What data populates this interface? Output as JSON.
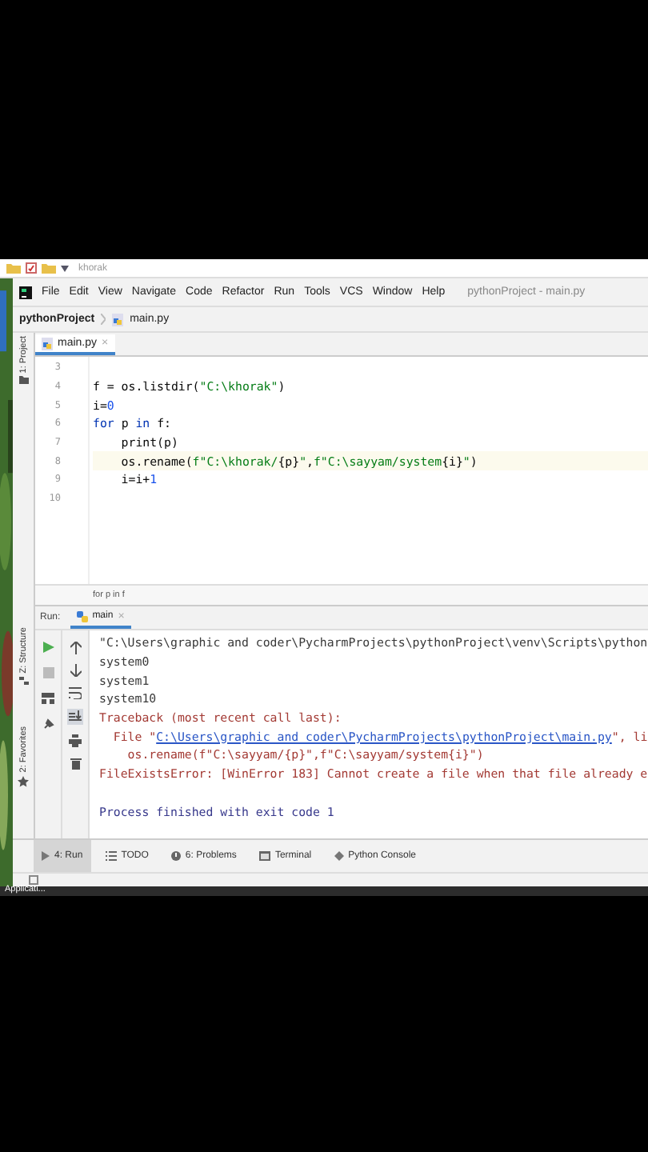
{
  "explorer": {
    "title": "khorak"
  },
  "menu": [
    "File",
    "Edit",
    "View",
    "Navigate",
    "Code",
    "Refactor",
    "Run",
    "Tools",
    "VCS",
    "Window",
    "Help"
  ],
  "window": {
    "title": "pythonProject - main.py"
  },
  "breadcrumb": {
    "project": "pythonProject",
    "file": "main.py"
  },
  "editor_tabs": [
    {
      "label": "main.py",
      "close": "×",
      "selected": true
    }
  ],
  "tool_strip": {
    "top": "1: Project",
    "middle": "Z: Structure",
    "bottom": "2: Favorites"
  },
  "code_lines": [
    {
      "number": "3",
      "current": false
    },
    {
      "number": "4",
      "current": false,
      "tokens": [
        {
          "kind": "plain",
          "text": "f = os.listdir("
        },
        {
          "kind": "string",
          "text": "\"C:\\khorak\""
        },
        {
          "kind": "plain",
          "text": ")"
        }
      ]
    },
    {
      "number": "5",
      "current": false,
      "tokens": [
        {
          "kind": "plain",
          "text": "i="
        },
        {
          "kind": "number",
          "text": "0"
        }
      ]
    },
    {
      "number": "6",
      "current": false,
      "tokens": [
        {
          "kind": "keyword",
          "text": "for "
        },
        {
          "kind": "plain",
          "text": "p "
        },
        {
          "kind": "keyword",
          "text": "in "
        },
        {
          "kind": "plain",
          "text": "f:"
        }
      ]
    },
    {
      "number": "7",
      "current": false,
      "tokens": [
        {
          "kind": "plain",
          "text": "    print(p)"
        }
      ]
    },
    {
      "number": "8",
      "current": true,
      "tokens": [
        {
          "kind": "plain",
          "text": "    os.rename("
        },
        {
          "kind": "string",
          "text": "f\"C:\\khorak/"
        },
        {
          "kind": "plain",
          "text": "{p}"
        },
        {
          "kind": "string",
          "text": "\""
        },
        {
          "kind": "plain",
          "text": ","
        },
        {
          "kind": "string",
          "text": "f\"C:\\sayyam/system"
        },
        {
          "kind": "plain",
          "text": "{i}"
        },
        {
          "kind": "string",
          "text": "\""
        },
        {
          "kind": "plain",
          "text": ")"
        }
      ]
    },
    {
      "number": "9",
      "current": false,
      "tokens": [
        {
          "kind": "plain",
          "text": "    i=i+"
        },
        {
          "kind": "number",
          "text": "1"
        }
      ]
    },
    {
      "number": "10",
      "current": false
    }
  ],
  "editor_breadcrumb": "for p in f",
  "run_panel": {
    "label": "Run:",
    "tab": "main",
    "close": "×"
  },
  "console_lines": [
    {
      "tokens": [
        {
          "kind": "command",
          "text": "\"C:\\Users\\graphic and coder\\PycharmProjects\\pythonProject\\venv\\Scripts\\python"
        }
      ]
    },
    {
      "tokens": [
        {
          "kind": "output",
          "text": "system0"
        }
      ]
    },
    {
      "tokens": [
        {
          "kind": "output",
          "text": "system1"
        }
      ]
    },
    {
      "tokens": [
        {
          "kind": "output",
          "text": "system10"
        }
      ]
    },
    {
      "tokens": [
        {
          "kind": "error",
          "text": "Traceback (most recent call last):"
        }
      ]
    },
    {
      "tokens": [
        {
          "kind": "error",
          "text": "  File \""
        },
        {
          "kind": "link",
          "text": "C:\\Users\\graphic and coder\\PycharmProjects\\pythonProject\\main.py"
        },
        {
          "kind": "error",
          "text": "\", li"
        }
      ]
    },
    {
      "tokens": [
        {
          "kind": "error",
          "text": "    os.rename(f\"C:\\sayyam/{p}\",f\"C:\\sayyam/system{i}\")"
        }
      ]
    },
    {
      "tokens": [
        {
          "kind": "error",
          "text": "FileExistsError: [WinError 183] Cannot create a file when that file already e"
        }
      ]
    },
    {
      "tokens": [
        {
          "kind": "status",
          "text": "Process finished with exit code 1"
        }
      ]
    }
  ],
  "tool_tabs": [
    {
      "kind": "run",
      "label": "4: Run",
      "selected": true
    },
    {
      "kind": "todo",
      "label": "TODO",
      "selected": false
    },
    {
      "kind": "problems",
      "label": "6: Problems",
      "selected": false
    },
    {
      "kind": "terminal",
      "label": "Terminal",
      "selected": false
    },
    {
      "kind": "console",
      "label": "Python Console",
      "selected": false
    }
  ],
  "taskbar": {
    "label": "Applicati..."
  }
}
